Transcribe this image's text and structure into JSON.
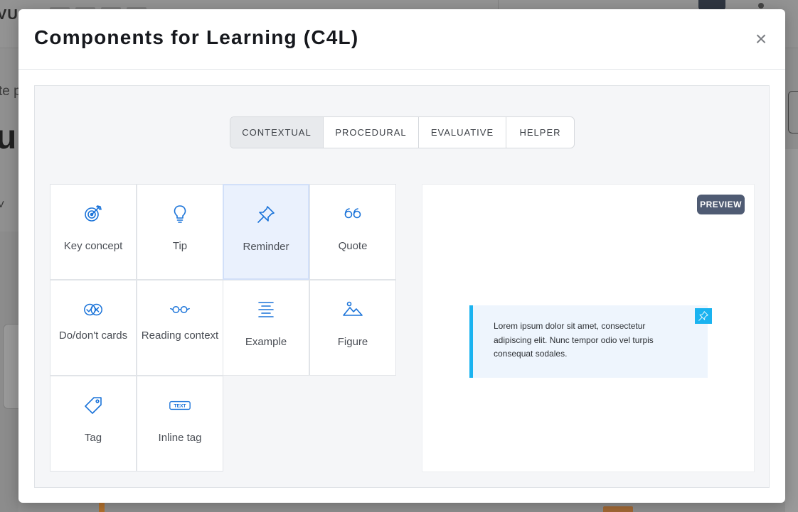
{
  "modal": {
    "title": "Components for Learning (C4L)",
    "close_symbol": "×"
  },
  "tabs": [
    {
      "label": "CONTEXTUAL",
      "active": true
    },
    {
      "label": "PROCEDURAL",
      "active": false
    },
    {
      "label": "EVALUATIVE",
      "active": false
    },
    {
      "label": "HELPER",
      "active": false
    }
  ],
  "components": [
    {
      "label": "Key concept",
      "icon": "target-icon"
    },
    {
      "label": "Tip",
      "icon": "lightbulb-icon"
    },
    {
      "label": "Reminder",
      "icon": "pushpin-icon",
      "selected": true
    },
    {
      "label": "Quote",
      "icon": "quote-icon"
    },
    {
      "label": "Do/don't cards",
      "icon": "check-x-icon"
    },
    {
      "label": "Reading context",
      "icon": "glasses-icon"
    },
    {
      "label": "Example",
      "icon": "text-align-icon"
    },
    {
      "label": "Figure",
      "icon": "mountain-image-icon"
    },
    {
      "label": "Tag",
      "icon": "tag-icon"
    },
    {
      "label": "Inline tag",
      "icon": "text-badge-icon",
      "icon_text": "TEXT"
    }
  ],
  "preview": {
    "badge": "PREVIEW",
    "text": "Lorem ipsum dolor sit amet, consectetur adipiscing elit. Nunc tempor odio vel turpis consequat sodales."
  },
  "colors": {
    "accent": "#1a73d9",
    "reminder_border": "#1ab3f0",
    "badge_bg": "#4f5b73",
    "selected_bg": "#eaf1fd"
  }
}
